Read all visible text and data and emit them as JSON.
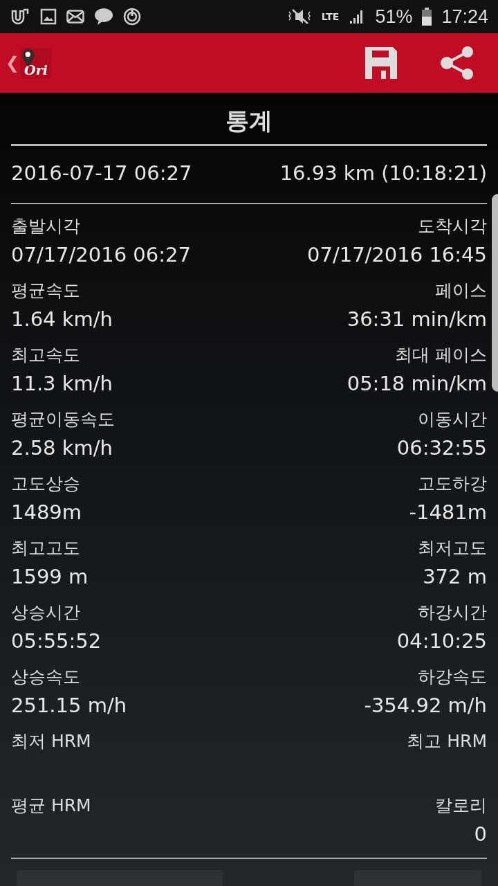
{
  "status_bar": {
    "battery": "51%",
    "time": "17:24",
    "network": "LTE"
  },
  "app_bar": {
    "back": "❮",
    "logo": "Ori"
  },
  "title": "통계",
  "summary": {
    "date": "2016-07-17 06:27",
    "distance": "16.93 km (10:18:21)"
  },
  "stats": [
    {
      "left": {
        "label": "출발시각",
        "value": "07/17/2016 06:27"
      },
      "right": {
        "label": "도착시각",
        "value": "07/17/2016 16:45"
      }
    },
    {
      "left": {
        "label": "평균속도",
        "value": "1.64 km/h"
      },
      "right": {
        "label": "페이스",
        "value": "36:31 min/km"
      }
    },
    {
      "left": {
        "label": "최고속도",
        "value": "11.3 km/h"
      },
      "right": {
        "label": "최대 페이스",
        "value": "05:18 min/km"
      }
    },
    {
      "left": {
        "label": "평균이동속도",
        "value": "2.58 km/h"
      },
      "right": {
        "label": "이동시간",
        "value": "06:32:55"
      }
    },
    {
      "left": {
        "label": "고도상승",
        "value": "1489m"
      },
      "right": {
        "label": "고도하강",
        "value": "-1481m"
      }
    },
    {
      "left": {
        "label": "최고고도",
        "value": "1599 m"
      },
      "right": {
        "label": "최저고도",
        "value": "372 m"
      }
    },
    {
      "left": {
        "label": "상승시간",
        "value": "05:55:52"
      },
      "right": {
        "label": "하강시간",
        "value": "04:10:25"
      }
    },
    {
      "left": {
        "label": "상승속도",
        "value": "251.15 m/h"
      },
      "right": {
        "label": "하강속도",
        "value": "-354.92 m/h"
      }
    },
    {
      "left": {
        "label": "최저 HRM"
      },
      "right": {
        "label": "최고 HRM"
      }
    },
    {
      "left": {
        "label": "평균 HRM"
      },
      "right": {
        "label": "칼로리",
        "value": "0"
      }
    }
  ]
}
